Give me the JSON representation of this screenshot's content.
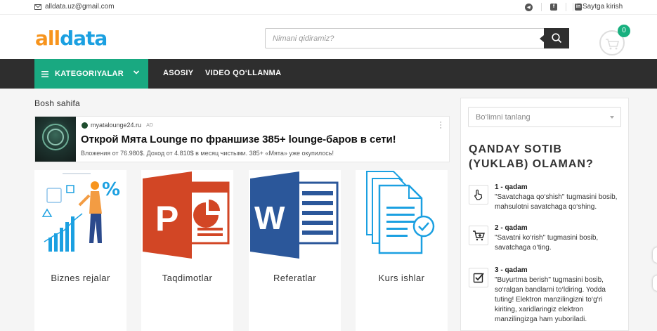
{
  "topbar": {
    "email": "alldata.uz@gmail.com",
    "socials": [
      "telegram-icon",
      "facebook-icon",
      "linkedin-icon"
    ],
    "login": "Saytga kirish"
  },
  "header": {
    "logo_part1": "all",
    "logo_part2": "data",
    "search_placeholder": "Nimani qidiramiz?",
    "cart_count": "0"
  },
  "nav": {
    "categories": "KATEGORIYALAR",
    "links": [
      "ASOSIY",
      "VIDEO QO‘LLANMA"
    ]
  },
  "breadcrumb": "Bosh sahifa",
  "ad": {
    "site": "myatalounge24.ru",
    "tag": "AD",
    "title": "Открой Мята Lounge по франшизе 385+ lounge-баров в сети!",
    "description": "Вложения от 76.980$. Доход от 4.810$ в месяц чистыми. 385+ «Мята» уже окупилось!"
  },
  "cards": [
    {
      "label": "Biznes rejalar"
    },
    {
      "label": "Taqdimotlar"
    },
    {
      "label": "Referatlar"
    },
    {
      "label": "Kurs ishlar"
    }
  ],
  "sidebar": {
    "select_placeholder": "Bo‘limni tanlang",
    "heading": "QANDAY SOTIB (YUKLAB) OLAMAN?",
    "steps": [
      {
        "title": "1 - qadam",
        "text": "\"Savatchaga qo‘shish\" tugmasini bosib, mahsulotni savatchaga qo‘shing.",
        "icon": "hand-pointer-icon"
      },
      {
        "title": "2 - qadam",
        "text": "\"Savatni ko‘rish\" tugmasini bosib, savatchaga o‘ting.",
        "icon": "cart-plus-icon"
      },
      {
        "title": "3 - qadam",
        "text": "\"Buyurtma berish\" tugmasini bosib, so‘ralgan bandlarni to‘ldiring. Yodda tuting! Elektron manzilingizni to‘g‘ri kiriting, xaridlaringiz elektron manzilingizga ham yuboriladi.",
        "icon": "checkbox-icon"
      }
    ]
  },
  "colors": {
    "accent": "#19a981",
    "nav_bg": "#2e2e2e",
    "logo_orange": "#f7941d",
    "logo_blue": "#1ba0e1",
    "powerpoint": "#d24625",
    "word": "#2b579a"
  }
}
